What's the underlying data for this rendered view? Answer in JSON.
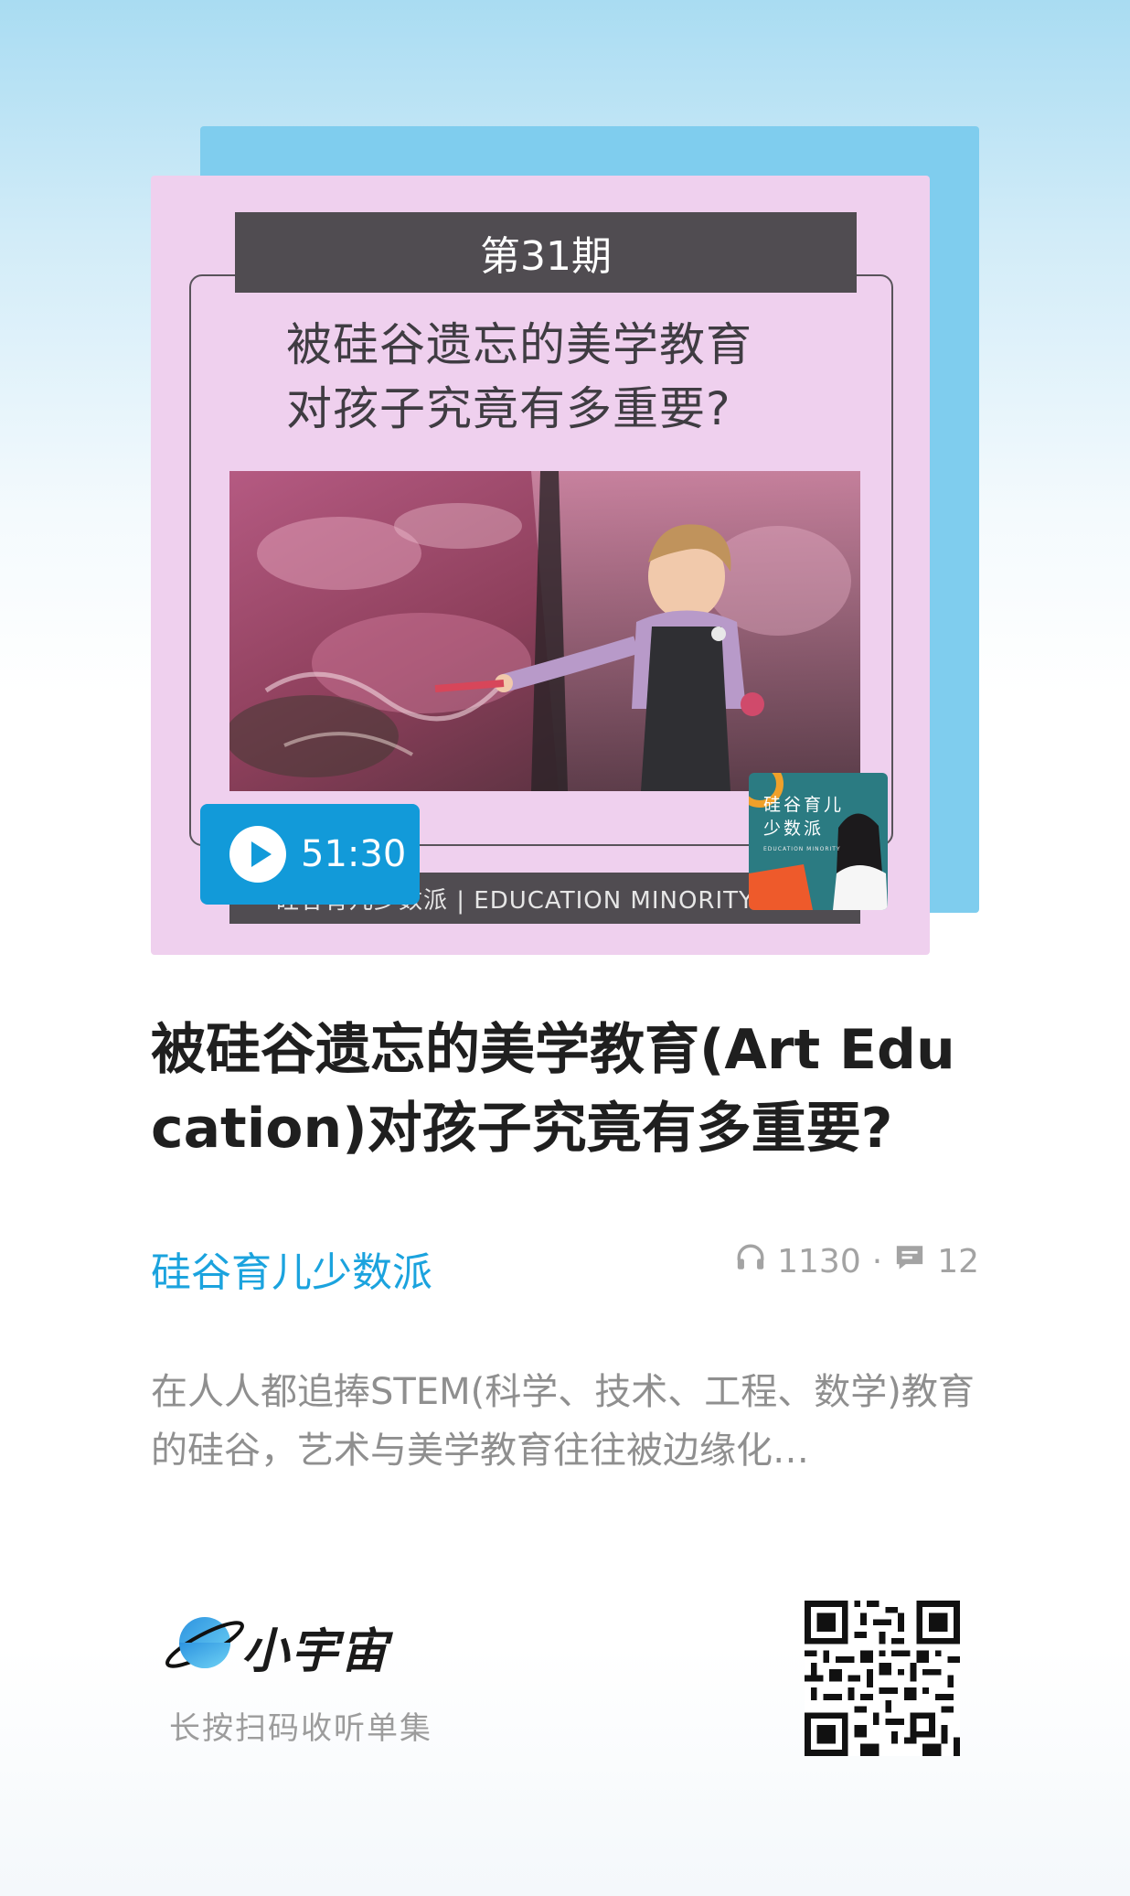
{
  "cover": {
    "episode": "第31期",
    "title": "被硅谷遗忘的美学教育\n对孩子究竟有多重要?",
    "bottom_strip": "硅谷育儿少数派 | EDUCATION MINORITY",
    "duration": "51:30",
    "thumb_title": "硅谷育儿\n少数派",
    "thumb_subtitle": "EDUCATION MINORITY"
  },
  "episode": {
    "title": "被硅谷遗忘的美学教育(Art Education)对孩子究竟有多重要?",
    "podcast_name": "硅谷育儿少数派",
    "play_count": "1130",
    "separator": "·",
    "comment_count": "12",
    "description": "在人人都追捧STEM(科学、技术、工程、数学)教育的硅谷，艺术与美学教育往往被边缘化…"
  },
  "footer": {
    "brand": "小宇宙",
    "scan_hint": "长按扫码收听单集"
  },
  "icons": {
    "play": "play-icon",
    "listen": "headphones-icon",
    "comment": "comment-icon",
    "logo": "planet-logo-icon",
    "qr": "qr-code"
  },
  "colors": {
    "accent": "#1ba3de",
    "play_pill": "#129ad9",
    "cover_bg": "#efd0ee",
    "back_card": "#7fcdee"
  }
}
